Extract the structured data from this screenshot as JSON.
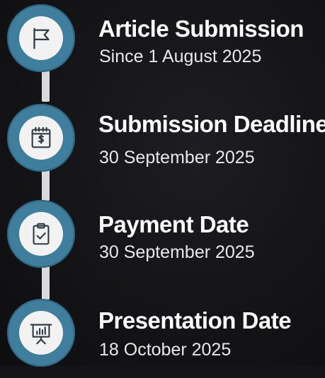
{
  "timeline": {
    "steps": [
      {
        "icon": "flag-icon",
        "title": "Article Submission",
        "subtitle": "Since 1 August 2025"
      },
      {
        "icon": "calendar-dollar-icon",
        "title": "Submission Deadline",
        "subtitle": "30 September 2025"
      },
      {
        "icon": "clipboard-check-icon",
        "title": "Payment Date",
        "subtitle": "30 September 2025"
      },
      {
        "icon": "presentation-board-icon",
        "title": "Presentation Date",
        "subtitle": "18 October 2025"
      }
    ]
  },
  "colors": {
    "background": "#141418",
    "node_ring": "#3f7f9d",
    "node_fill": "#f2f2f3",
    "connector": "#d9d9dc",
    "icon_stroke": "#2f3a44",
    "text": "#ffffff"
  }
}
